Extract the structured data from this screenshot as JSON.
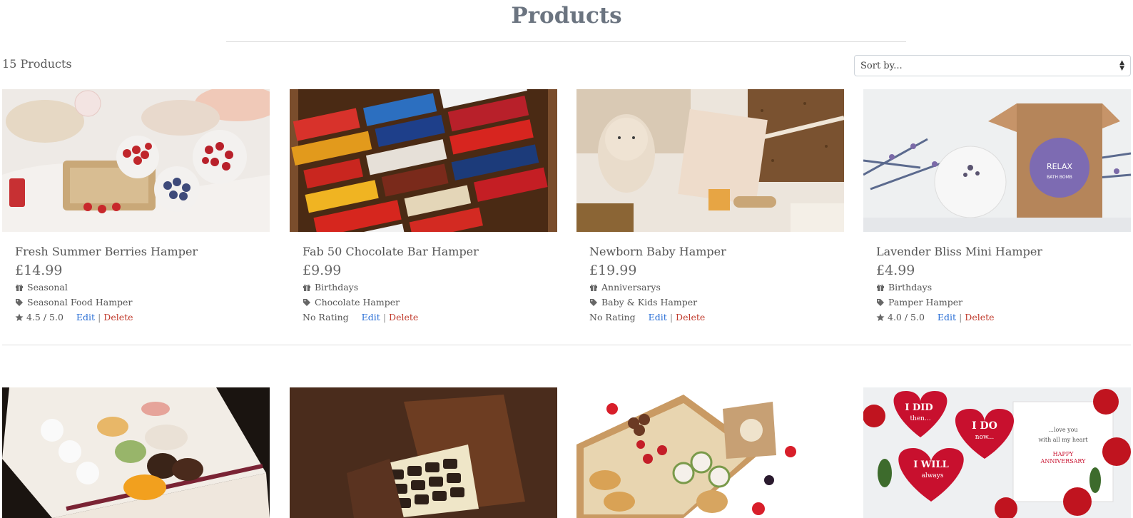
{
  "page": {
    "title": "Products",
    "count_label": "15 Products"
  },
  "sort": {
    "label": "Sort by..."
  },
  "products": [
    {
      "name": "Fresh Summer Berries Hamper",
      "price": "£14.99",
      "category": "Seasonal",
      "type": "Seasonal Food Hamper",
      "rating": "4.5 / 5.0",
      "edit": "Edit",
      "delete": "Delete"
    },
    {
      "name": "Fab 50 Chocolate Bar Hamper",
      "price": "£9.99",
      "category": "Birthdays",
      "type": "Chocolate Hamper",
      "rating": "No Rating",
      "edit": "Edit",
      "delete": "Delete"
    },
    {
      "name": "Newborn Baby Hamper",
      "price": "£19.99",
      "category": "Anniversarys",
      "type": "Baby & Kids Hamper",
      "rating": "No Rating",
      "edit": "Edit",
      "delete": "Delete"
    },
    {
      "name": "Lavender Bliss Mini Hamper",
      "price": "£4.99",
      "category": "Birthdays",
      "type": "Pamper Hamper",
      "rating": "4.0 / 5.0",
      "edit": "Edit",
      "delete": "Delete"
    }
  ],
  "images": {
    "berries": "Fresh Summer Berries Hamper image",
    "chocolate": "Fab 50 Chocolate Bar Hamper image",
    "baby": "Newborn Baby Hamper image",
    "lavender": "Lavender Bliss Mini Hamper image",
    "sweets": "Sweets box image",
    "truffles": "Chocolate truffle box image",
    "picnic": "Picnic food box image",
    "anniversary": "Anniversary hearts image"
  },
  "anniversary_card": {
    "heart1_line1": "I DID",
    "heart1_line2": "then...",
    "heart2_line1": "I DO",
    "heart2_line2": "now...",
    "heart3_line1": "I WILL",
    "heart3_line2": "always",
    "note_line1": "...love you",
    "note_line2": "with all my heart",
    "note_line3": "HAPPY",
    "note_line4": "ANNIVERSARY"
  },
  "lavender_box": {
    "brand": "RELAX",
    "sub": "BATH BOMB"
  },
  "colors": {
    "edit": "#2a6fd6",
    "delete": "#c0392b",
    "title": "#6b7480"
  }
}
